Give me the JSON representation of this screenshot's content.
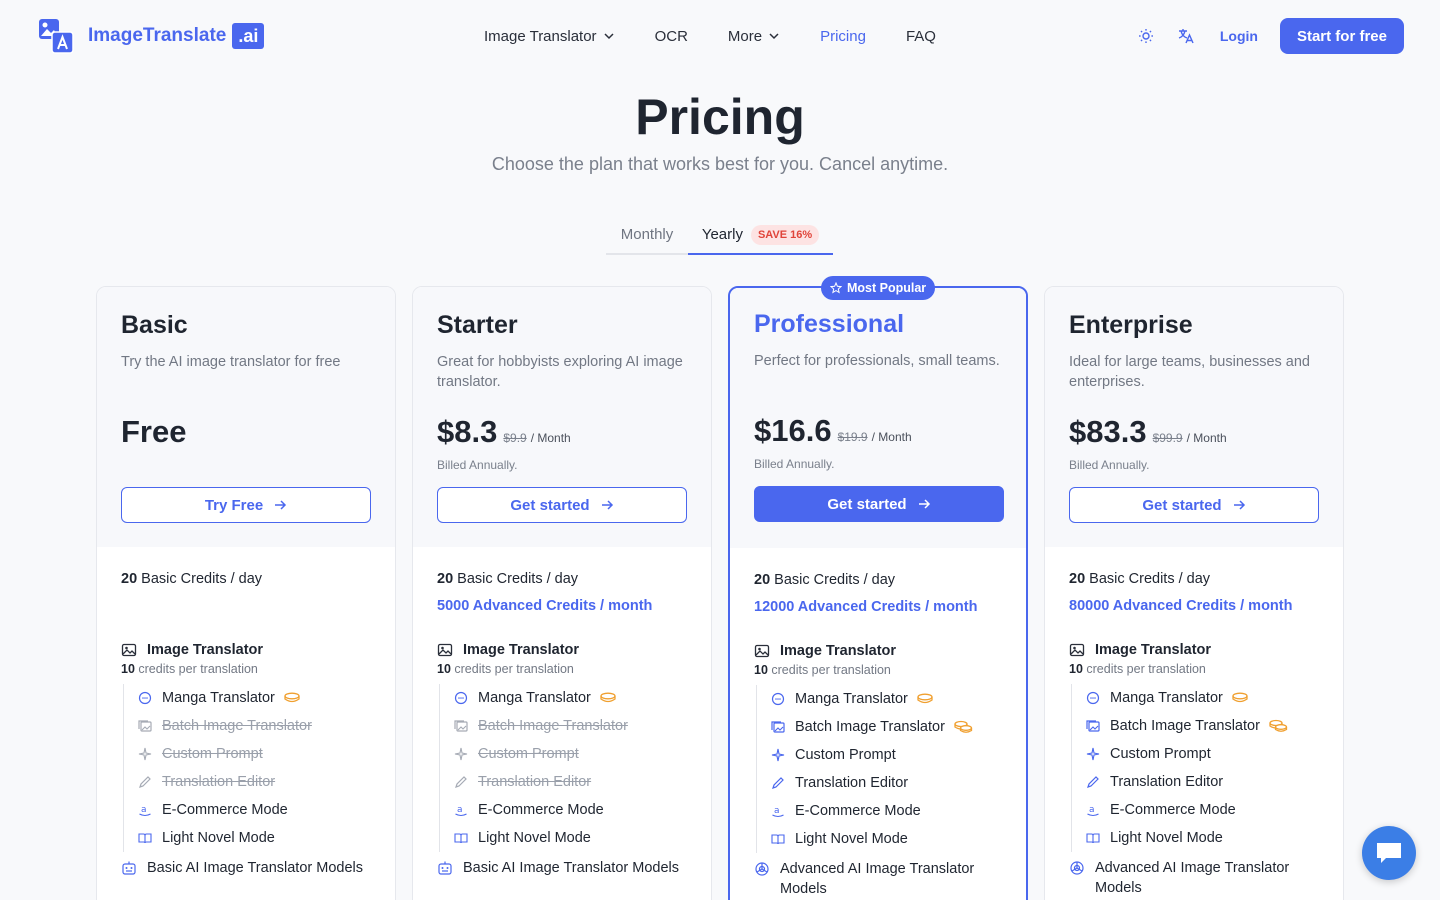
{
  "header": {
    "brand": "ImageTranslate",
    "brand_badge": ".ai",
    "nav": [
      {
        "label": "Image Translator",
        "dropdown": true
      },
      {
        "label": "OCR",
        "dropdown": false
      },
      {
        "label": "More",
        "dropdown": true
      },
      {
        "label": "Pricing",
        "dropdown": false,
        "active": true
      },
      {
        "label": "FAQ",
        "dropdown": false
      }
    ],
    "theme_icon": "sun-icon",
    "lang_icon": "translate-icon",
    "login": "Login",
    "start": "Start for free"
  },
  "hero": {
    "title": "Pricing",
    "subtitle": "Choose the plan that works best for you. Cancel anytime."
  },
  "billing_toggle": {
    "monthly": "Monthly",
    "yearly": "Yearly",
    "save_badge": "SAVE 16%",
    "selected": "yearly"
  },
  "popular_badge": "Most Popular",
  "plans": [
    {
      "name": "Basic",
      "desc": "Try the AI image translator for free",
      "price": "Free",
      "price_old": "",
      "per": "",
      "billed": "",
      "cta": "Try Free",
      "basic_credits_num": "20",
      "basic_credits_text": " Basic Credits / day",
      "advanced_credits": "",
      "main_feature": "Image Translator",
      "per_num": "10",
      "per_text": " credits per translation",
      "features": [
        {
          "label": "Manga Translator",
          "enabled": true,
          "coin": "single"
        },
        {
          "label": "Batch Image Translator",
          "enabled": false,
          "coin": ""
        },
        {
          "label": "Custom Prompt",
          "enabled": false,
          "coin": ""
        },
        {
          "label": "Translation Editor",
          "enabled": false,
          "coin": ""
        },
        {
          "label": "E-Commerce Mode",
          "enabled": true,
          "coin": ""
        },
        {
          "label": "Light Novel Mode",
          "enabled": true,
          "coin": ""
        }
      ],
      "models": "Basic AI Image Translator Models"
    },
    {
      "name": "Starter",
      "desc": "Great for hobbyists exploring AI image translator.",
      "price": "$8.3",
      "price_old": "$9.9",
      "per": "/ Month",
      "billed": "Billed Annually.",
      "cta": "Get started",
      "basic_credits_num": "20",
      "basic_credits_text": " Basic Credits / day",
      "advanced_credits": "5000 Advanced Credits / month",
      "main_feature": "Image Translator",
      "per_num": "10",
      "per_text": " credits per translation",
      "features": [
        {
          "label": "Manga Translator",
          "enabled": true,
          "coin": "single"
        },
        {
          "label": "Batch Image Translator",
          "enabled": false,
          "coin": ""
        },
        {
          "label": "Custom Prompt",
          "enabled": false,
          "coin": ""
        },
        {
          "label": "Translation Editor",
          "enabled": false,
          "coin": ""
        },
        {
          "label": "E-Commerce Mode",
          "enabled": true,
          "coin": ""
        },
        {
          "label": "Light Novel Mode",
          "enabled": true,
          "coin": ""
        }
      ],
      "models": "Basic AI Image Translator Models"
    },
    {
      "name": "Professional",
      "desc": "Perfect for professionals, small teams.",
      "price": "$16.6",
      "price_old": "$19.9",
      "per": "/ Month",
      "billed": "Billed Annually.",
      "cta": "Get started",
      "basic_credits_num": "20",
      "basic_credits_text": " Basic Credits / day",
      "advanced_credits": "12000 Advanced Credits / month",
      "main_feature": "Image Translator",
      "per_num": "10",
      "per_text": " credits per translation",
      "features": [
        {
          "label": "Manga Translator",
          "enabled": true,
          "coin": "single"
        },
        {
          "label": "Batch Image Translator",
          "enabled": true,
          "coin": "stack"
        },
        {
          "label": "Custom Prompt",
          "enabled": true,
          "coin": ""
        },
        {
          "label": "Translation Editor",
          "enabled": true,
          "coin": ""
        },
        {
          "label": "E-Commerce Mode",
          "enabled": true,
          "coin": ""
        },
        {
          "label": "Light Novel Mode",
          "enabled": true,
          "coin": ""
        }
      ],
      "models": "Advanced AI Image Translator Models"
    },
    {
      "name": "Enterprise",
      "desc": "Ideal for large teams, businesses and enterprises.",
      "price": "$83.3",
      "price_old": "$99.9",
      "per": "/ Month",
      "billed": "Billed Annually.",
      "cta": "Get started",
      "basic_credits_num": "20",
      "basic_credits_text": " Basic Credits / day",
      "advanced_credits": "80000 Advanced Credits / month",
      "main_feature": "Image Translator",
      "per_num": "10",
      "per_text": " credits per translation",
      "features": [
        {
          "label": "Manga Translator",
          "enabled": true,
          "coin": "single"
        },
        {
          "label": "Batch Image Translator",
          "enabled": true,
          "coin": "stack"
        },
        {
          "label": "Custom Prompt",
          "enabled": true,
          "coin": ""
        },
        {
          "label": "Translation Editor",
          "enabled": true,
          "coin": ""
        },
        {
          "label": "E-Commerce Mode",
          "enabled": true,
          "coin": ""
        },
        {
          "label": "Light Novel Mode",
          "enabled": true,
          "coin": ""
        }
      ],
      "models": "Advanced AI Image Translator Models"
    }
  ],
  "colors": {
    "accent": "#4a67ee",
    "save_badge_bg": "#fde3e3",
    "save_badge_text": "#e0443a",
    "coin": "#f0a030",
    "chat": "#3b7ee6"
  },
  "chat_icon": "chat-bubble-icon"
}
